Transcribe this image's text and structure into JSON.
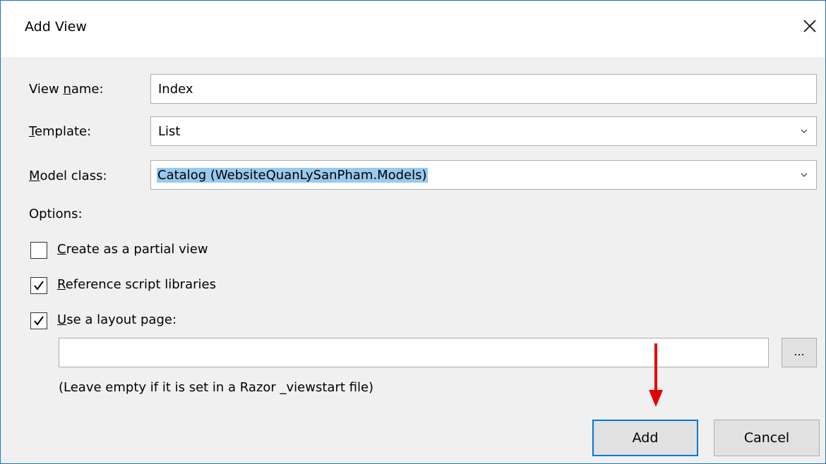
{
  "window": {
    "title": "Add View"
  },
  "form": {
    "view_name": {
      "label_pre": "View ",
      "label_ul": "n",
      "label_post": "ame:",
      "value": "Index"
    },
    "template": {
      "label_pre": "",
      "label_ul": "T",
      "label_post": "emplate:",
      "value": "List"
    },
    "model_class": {
      "label_pre": "",
      "label_ul": "M",
      "label_post": "odel class:",
      "value": "Catalog (WebsiteQuanLySanPham.Models)"
    }
  },
  "options": {
    "heading": "Options:",
    "partial": {
      "ul": "C",
      "rest": "reate as a partial view",
      "checked": false
    },
    "script_libs": {
      "ul": "R",
      "rest": "eference script libraries",
      "checked": true
    },
    "layout_page": {
      "ul": "U",
      "rest": "se a layout page:",
      "checked": true
    },
    "layout_value": "",
    "browse_label": "...",
    "hint": "(Leave empty if it is set in a Razor _viewstart file)"
  },
  "buttons": {
    "add": "Add",
    "cancel": "Cancel"
  },
  "colors": {
    "accent": "#0078d7",
    "selection": "#99c9ef",
    "arrow": "#e60000"
  }
}
